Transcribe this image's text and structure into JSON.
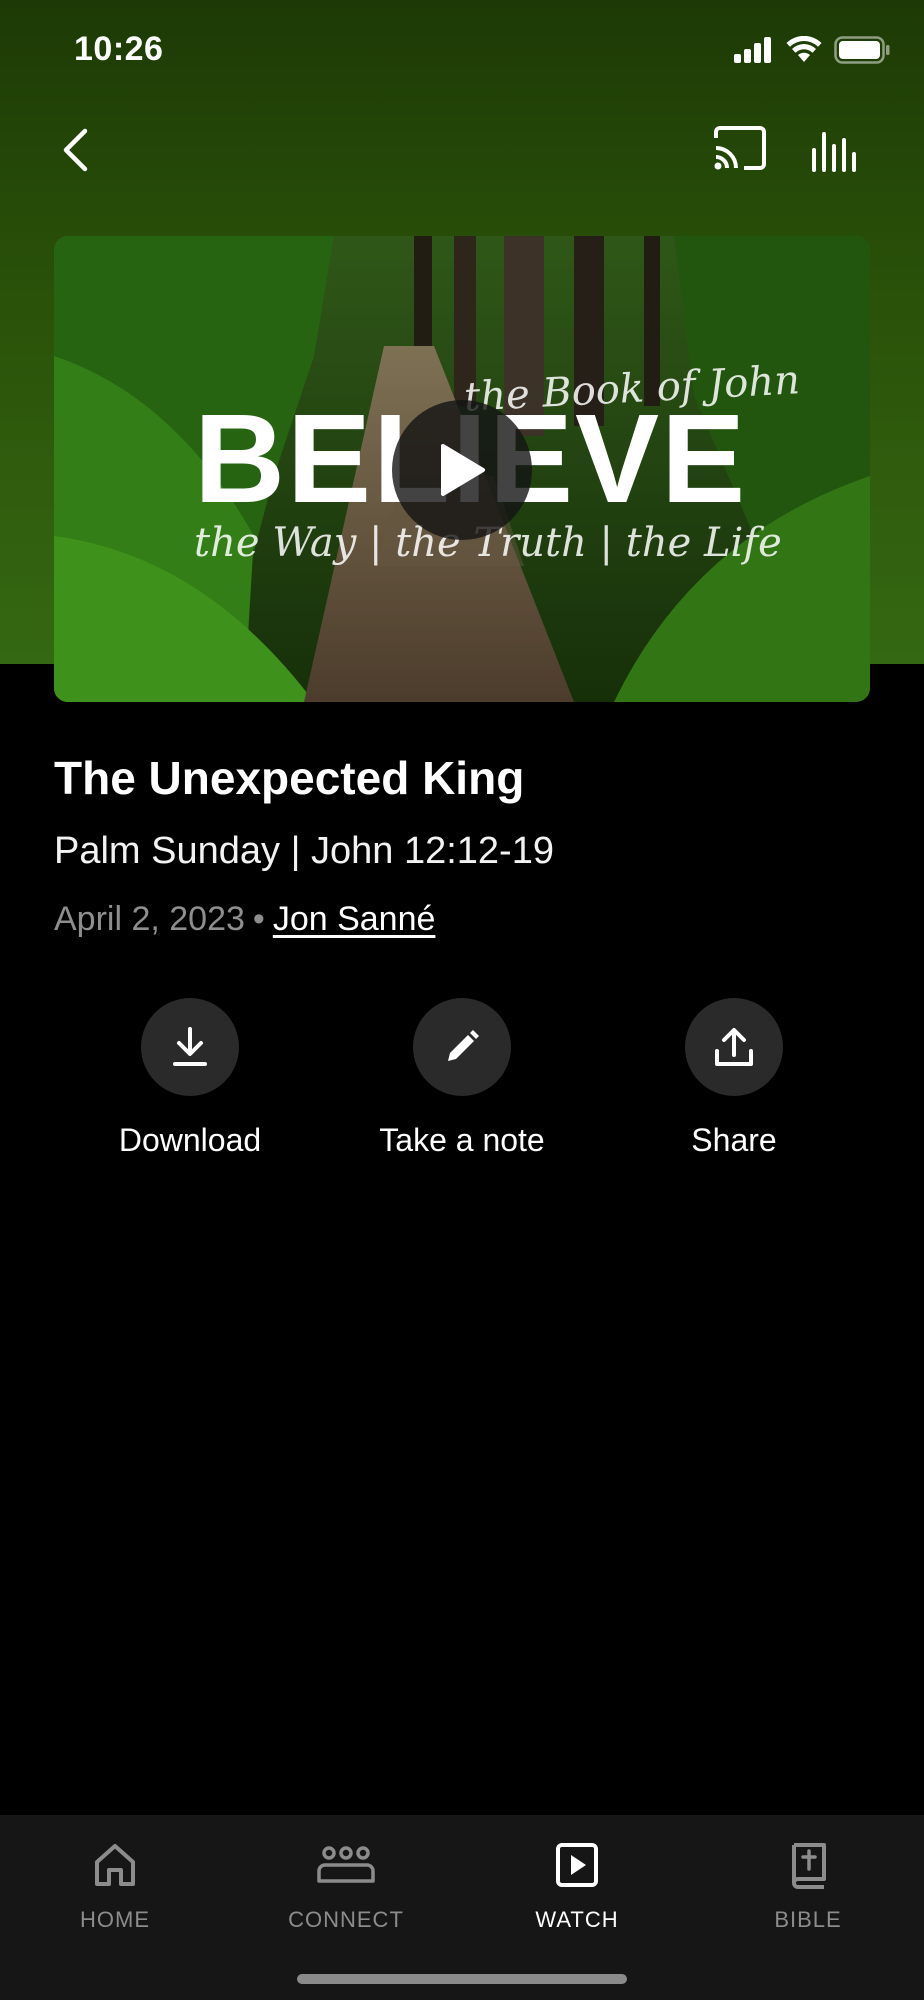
{
  "status_bar": {
    "time": "10:26"
  },
  "video": {
    "series_top": "the Book of John",
    "series_title": "BELIEVE",
    "series_bottom": "the Way | the Truth | the Life"
  },
  "sermon": {
    "title": "The Unexpected King",
    "subtitle": "Palm Sunday | John 12:12-19",
    "date": "April 2, 2023",
    "separator": "•",
    "author": "Jon Sanné"
  },
  "actions": [
    {
      "label": "Download",
      "icon": "download-icon"
    },
    {
      "label": "Take a note",
      "icon": "pencil-icon"
    },
    {
      "label": "Share",
      "icon": "share-icon"
    }
  ],
  "tabs": [
    {
      "label": "HOME",
      "icon": "home-icon",
      "active": false
    },
    {
      "label": "CONNECT",
      "icon": "people-icon",
      "active": false
    },
    {
      "label": "WATCH",
      "icon": "play-square-icon",
      "active": true
    },
    {
      "label": "BIBLE",
      "icon": "bible-icon",
      "active": false
    }
  ],
  "colors": {
    "header_green": "#2a5209",
    "background": "#000000",
    "tab_bar": "#161616",
    "action_circle": "#2a2a2a"
  }
}
